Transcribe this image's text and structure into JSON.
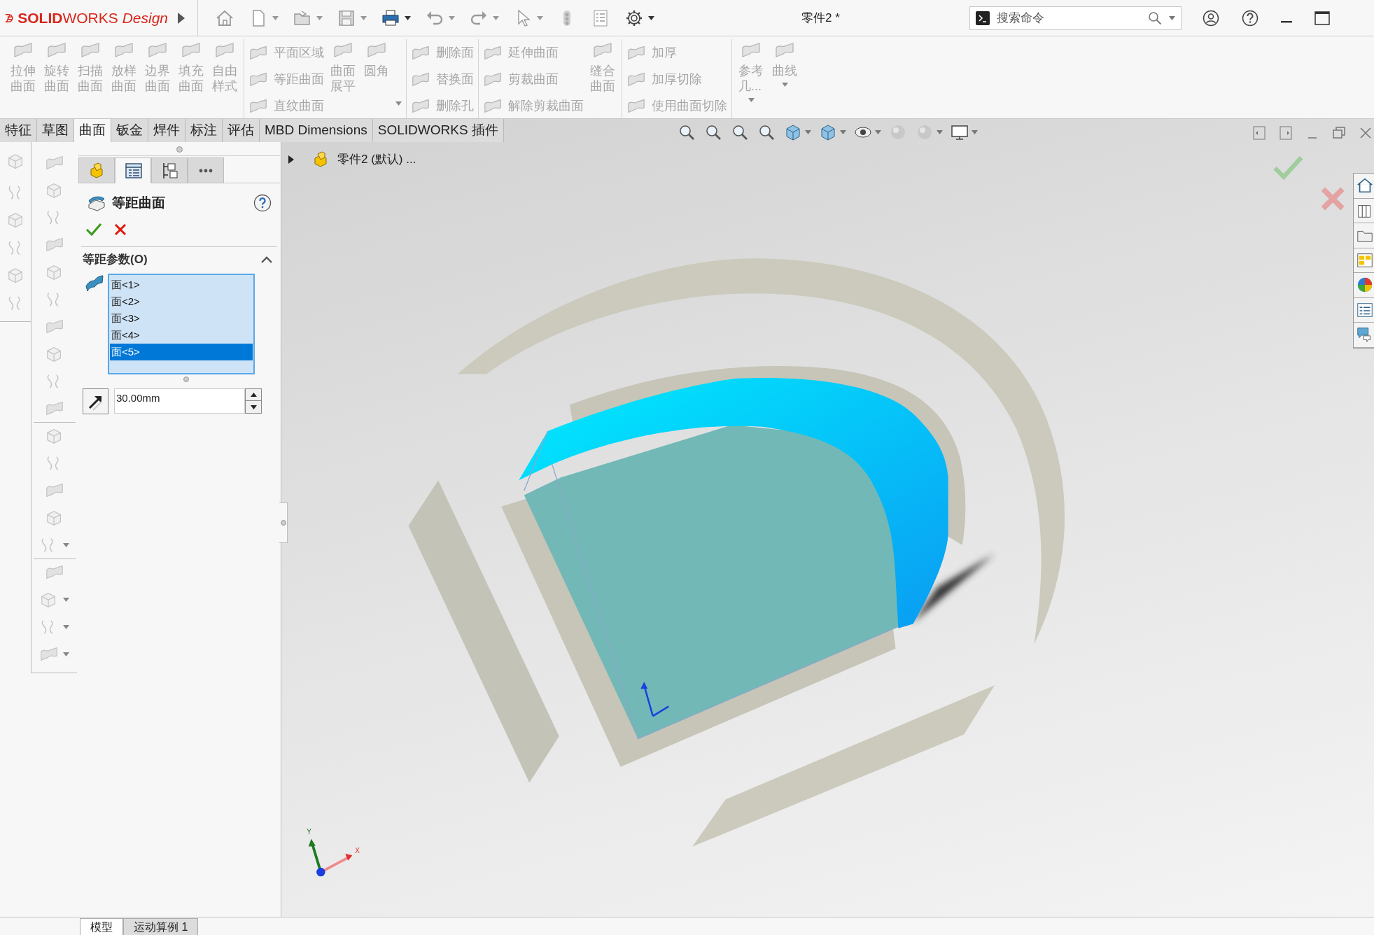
{
  "app": {
    "logo": "**SOLID**WORKS *Design*"
  },
  "window": {
    "title": "零件2 *"
  },
  "search": {
    "placeholder": "搜索命令"
  },
  "ribbon": [
    {
      "items": [
        {
          "label": "拉伸曲面",
          "kind": "large",
          "disabled": true
        },
        {
          "label": "旋转曲面",
          "kind": "large",
          "disabled": true
        },
        {
          "label": "扫描曲面",
          "kind": "large",
          "disabled": true
        },
        {
          "label": "放样曲面",
          "kind": "large",
          "disabled": true
        },
        {
          "label": "边界曲面",
          "kind": "large",
          "disabled": true
        },
        {
          "label": "填充曲面",
          "kind": "large",
          "disabled": true
        },
        {
          "label": "自由样式",
          "kind": "large",
          "disabled": true
        }
      ]
    },
    {
      "items": [
        {
          "label": "平面区域",
          "kind": "small",
          "disabled": true
        },
        {
          "label": "等距曲面",
          "kind": "small",
          "disabled": true
        },
        {
          "label": "直纹曲面",
          "kind": "small",
          "disabled": true
        },
        {
          "label": "曲面展平",
          "kind": "large",
          "disabled": true
        },
        {
          "label": "圆角",
          "kind": "large",
          "disabled": true
        }
      ]
    },
    {
      "items": [
        {
          "label": "删除面",
          "kind": "small",
          "disabled": true
        },
        {
          "label": "替换面",
          "kind": "small",
          "disabled": true
        },
        {
          "label": "删除孔",
          "kind": "small",
          "disabled": true
        }
      ]
    },
    {
      "items": [
        {
          "label": "延伸曲面",
          "kind": "small",
          "disabled": true
        },
        {
          "label": "剪裁曲面",
          "kind": "small",
          "disabled": true
        },
        {
          "label": "解除剪裁曲面",
          "kind": "small",
          "disabled": true
        },
        {
          "label": "缝合曲面",
          "kind": "large",
          "disabled": true
        }
      ]
    },
    {
      "items": [
        {
          "label": "加厚",
          "kind": "small",
          "disabled": true
        },
        {
          "label": "加厚切除",
          "kind": "small",
          "disabled": true
        },
        {
          "label": "使用曲面切除",
          "kind": "small",
          "disabled": true
        }
      ]
    },
    {
      "items": [
        {
          "label": "参考几...",
          "kind": "large",
          "disabled": true
        },
        {
          "label": "曲线",
          "kind": "large",
          "disabled": true
        }
      ]
    }
  ],
  "tabs": [
    {
      "label": "特征",
      "selected": false
    },
    {
      "label": "草图",
      "selected": false
    },
    {
      "label": "曲面",
      "selected": true
    },
    {
      "label": "钣金",
      "selected": false
    },
    {
      "label": "焊件",
      "selected": false
    },
    {
      "label": "标注",
      "selected": false
    },
    {
      "label": "评估",
      "selected": false
    },
    {
      "label": "MBD Dimensions",
      "selected": false
    },
    {
      "label": "SOLIDWORKS 插件",
      "selected": false
    }
  ],
  "panel_tabs": [
    {
      "selected": false
    },
    {
      "selected": true
    },
    {
      "selected": false
    },
    {
      "selected": false
    }
  ],
  "property_manager": {
    "title": "等距曲面",
    "section": "等距参数(O)",
    "section_expanded": true,
    "faces": [
      {
        "label": "面<1>",
        "selected": false
      },
      {
        "label": "面<2>",
        "selected": false
      },
      {
        "label": "面<3>",
        "selected": false
      },
      {
        "label": "面<4>",
        "selected": false
      },
      {
        "label": "面<5>",
        "selected": true
      }
    ],
    "distance": "30.00mm"
  },
  "feature_tree": {
    "root": "零件2 (默认) ...",
    "expanded": false
  },
  "triad": {
    "x_label": "X",
    "y_label": "Y"
  },
  "bottom_tabs": [
    {
      "label": "模型",
      "selected": true
    },
    {
      "label": "运动算例 1",
      "selected": false
    }
  ]
}
